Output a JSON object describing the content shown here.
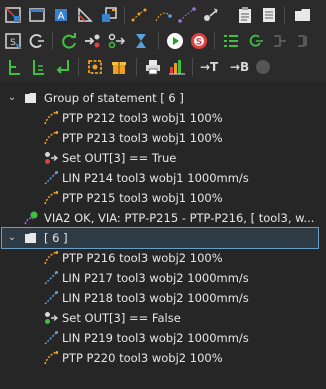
{
  "toolbar": {
    "row1": [
      "grid-icon",
      "window-icon",
      "text-a-icon",
      "ruler-icon",
      "paste-icon",
      "path-icon",
      "path-orange-icon",
      "path-purple-icon",
      "move-icon",
      "clipboard-icon",
      "list-icon",
      "folder-icon"
    ],
    "row2": [
      "record-icon",
      "circle-c-icon",
      "refresh-icon",
      "transfer-icon",
      "relay-icon",
      "hourglass-icon",
      "play-icon",
      "stop-icon",
      "check-list-icon",
      "loop-icon",
      "disabled-a-icon",
      "disabled-b-icon"
    ],
    "row3": [
      "branch-icon",
      "branch2-icon",
      "return-icon",
      "target-icon",
      "gift-icon",
      "printer-icon",
      "bar-chart-icon",
      "insert-t-icon",
      "insert-b-icon",
      "disabled-dot-icon"
    ],
    "insert_t_label": "→T",
    "insert_b_label": "→B"
  },
  "tree": {
    "group1": {
      "label": "Group of statement [ 6 ]",
      "items": [
        {
          "label": "PTP P212 tool3 wobj1 100%",
          "type": "ptp"
        },
        {
          "label": "PTP P213 tool3 wobj1 100%",
          "type": "ptp"
        },
        {
          "label": "Set OUT[3] == True",
          "type": "set"
        },
        {
          "label": "LIN P214 tool3 wobj1 1000mm/s",
          "type": "lin"
        },
        {
          "label": "PTP P215 tool3 wobj1 100%",
          "type": "ptp"
        }
      ]
    },
    "via": {
      "label": "VIA2 OK, VIA: PTP-P215 - PTP-P216,  [ tool3, w..."
    },
    "group2": {
      "label": "[ 6 ]",
      "items": [
        {
          "label": "PTP P216 tool3 wobj2 100%",
          "type": "ptp"
        },
        {
          "label": "LIN P217 tool3 wobj2 1000mm/s",
          "type": "lin"
        },
        {
          "label": "LIN P218 tool3 wobj2 1000mm/s",
          "type": "lin"
        },
        {
          "label": "Set OUT[3] == False",
          "type": "set"
        },
        {
          "label": "LIN P219 tool3 wobj2 1000mm/s",
          "type": "lin"
        },
        {
          "label": "PTP P220 tool3 wobj2 100%",
          "type": "ptp"
        }
      ]
    }
  },
  "colors": {
    "background": "#262626",
    "selection_border": "#6aa0c8",
    "ptp": "#f0a020",
    "lin": "#5aa0e0",
    "text": "#e6e6e6"
  }
}
